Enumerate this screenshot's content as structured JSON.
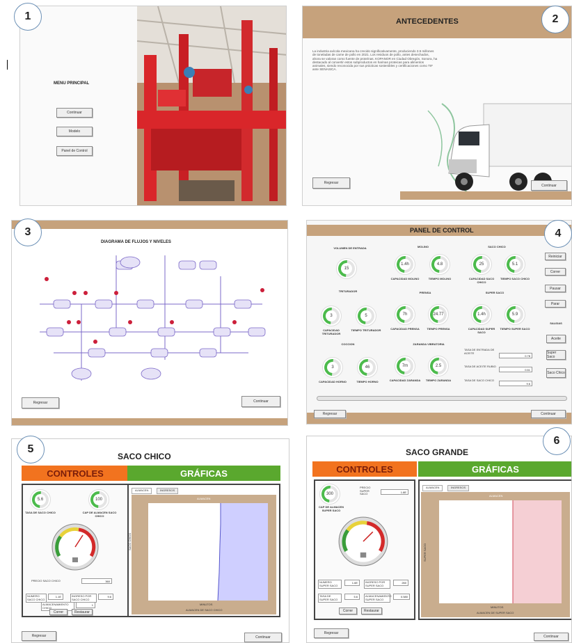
{
  "badges": [
    "1",
    "2",
    "3",
    "4",
    "5",
    "6"
  ],
  "p1": {
    "title": "MENU PRINCIPAL",
    "buttons": [
      "Continuar",
      "Modelo",
      "Panel de Control"
    ]
  },
  "p2": {
    "title": "ANTECEDENTES",
    "text": "La industria avícola mexicana ha crecido significativamente, produciendo 3.5 millones de toneladas de carne de pollo en 2021. Los residuos de pollo, antes desechados, ahora se valoran como fuente de proteínas. KOPANOR en Ciudad Obregón, Sonora, ha destacado al convertir estos subproductos en harinas proteicas para alimentos animales, siendo reconocida por sus prácticas sostenibles y certificaciones como TIF ante SENASICA.",
    "back": "Regresar",
    "next": "Continuar"
  },
  "p3": {
    "title": "DIAGRAMA DE FLUJOS Y NIVELES",
    "back": "Regresar",
    "next": "Continuar"
  },
  "p4": {
    "title": "PANEL DE CONTROL",
    "sections": {
      "entrada": "VOLUMEN DE ENTRADA",
      "molino": "MOLINO",
      "saco_chico": "SACO CHICO",
      "triturador": "TRITURADOR",
      "prensa": "PRENSA",
      "super_saco": "SUPER SACO",
      "coccion": "COCCION",
      "zaranda": "ZARANDA VIBRATORIA"
    },
    "gauges": [
      {
        "value": "15",
        "label": ""
      },
      {
        "value": "1.4h",
        "label": "CAPACIDAD MOLINO"
      },
      {
        "value": "4.8",
        "label": "TIEMPO MOLINO"
      },
      {
        "value": "25",
        "label": "CAPACIDAD SACO CHICO"
      },
      {
        "value": "5.1",
        "label": "TIEMPO SACO CHICO"
      },
      {
        "value": "3",
        "label": "CAPACIDAD TRITURADOR"
      },
      {
        "value": "5",
        "label": "TIEMPO TRITURADOR"
      },
      {
        "value": "7h",
        "label": "CAPACIDAD PRENSA"
      },
      {
        "value": "24.77",
        "label": "TIEMPO PRENSA"
      },
      {
        "value": "1.4h",
        "label": "CAPACIDAD SUPER SACO"
      },
      {
        "value": "5.9",
        "label": "TIEMPO SUPER SACO"
      },
      {
        "value": "3",
        "label": "CAPACIDAD HORNO"
      },
      {
        "value": "46",
        "label": "TIEMPO HORNO"
      },
      {
        "value": "7m",
        "label": "CAPACIDAD ZARANDA"
      },
      {
        "value": "2.5",
        "label": "TIEMPO ZARANDA"
      }
    ],
    "rates": [
      {
        "label": "TASA DE ENTRADA DE ACEITE",
        "value": "0.78"
      },
      {
        "label": "TASA DE ACEITE RUBIO",
        "value": "0.61"
      },
      {
        "label": "TASA DE SACO CHICO",
        "value": "9.6"
      }
    ],
    "control_title": "CONTROL",
    "control_buttons": [
      "Reiniciar",
      "Correr",
      "Pausar",
      "Parar"
    ],
    "salidas_title": "SALIDAS",
    "salidas_buttons": [
      "Aceite",
      "Super Saco",
      "Saco Chico"
    ],
    "back": "Regresar",
    "next": "Continuar"
  },
  "p5": {
    "title": "SACO CHICO",
    "controles": "CONTROLES",
    "graficas": "GRÁFICAS",
    "gauges": [
      {
        "value": "5.6",
        "label": "TASA DE SACO CHICO"
      },
      {
        "value": "100",
        "label": "CAP DE ALMACEN SACO CHICO"
      }
    ],
    "price_label": "PRECIO SACO CHICO",
    "price_value": "360",
    "fields": [
      {
        "label": "NUMERO SACO CHICO",
        "value": "1.1E"
      },
      {
        "label": "INGRESO POR SACO CHICO",
        "value": "9.6"
      },
      {
        "label": "ALMACENAMIENTO CHICO",
        "value": "1"
      }
    ],
    "buttons": [
      "Correr",
      "Restaurar"
    ],
    "tabs": [
      "ALMACEN",
      "INGRESOS"
    ],
    "plot_title": "ALMACEN",
    "xlabel": "MINUTOS",
    "ylabel": "SACO CHICO",
    "legend": "ALMACEN DE SACO CHICO",
    "back": "Regresar",
    "next": "Continuar"
  },
  "p6": {
    "title": "SACO GRANDE",
    "controles": "CONTROLES",
    "graficas": "GRÁFICAS",
    "gauge": {
      "value": "300",
      "label": "CAP DE ALMACEN SUPER SACO"
    },
    "price_label": "PRECIO SUPER SACO",
    "price_value": "1.8E",
    "fields": [
      {
        "label": "NUMERO SUPER SACO",
        "value": "1.6E"
      },
      {
        "label": "INGRESO POR SUPER SACO",
        "value": "260"
      },
      {
        "label": "TASA DE SUPER SACO",
        "value": "5.6"
      },
      {
        "label": "ALMACENAMIENTO SUPER SACO",
        "value": "0.580"
      }
    ],
    "buttons": [
      "Correr",
      "Restaurar"
    ],
    "tabs": [
      "ALMACEN",
      "INGRESOS"
    ],
    "plot_title": "ALMACEN",
    "xlabel": "MINUTOS",
    "ylabel": "SUPER SACO",
    "legend": "ALMACEN DE SUPER SACO",
    "back": "Regresar",
    "next": "Continuar"
  }
}
